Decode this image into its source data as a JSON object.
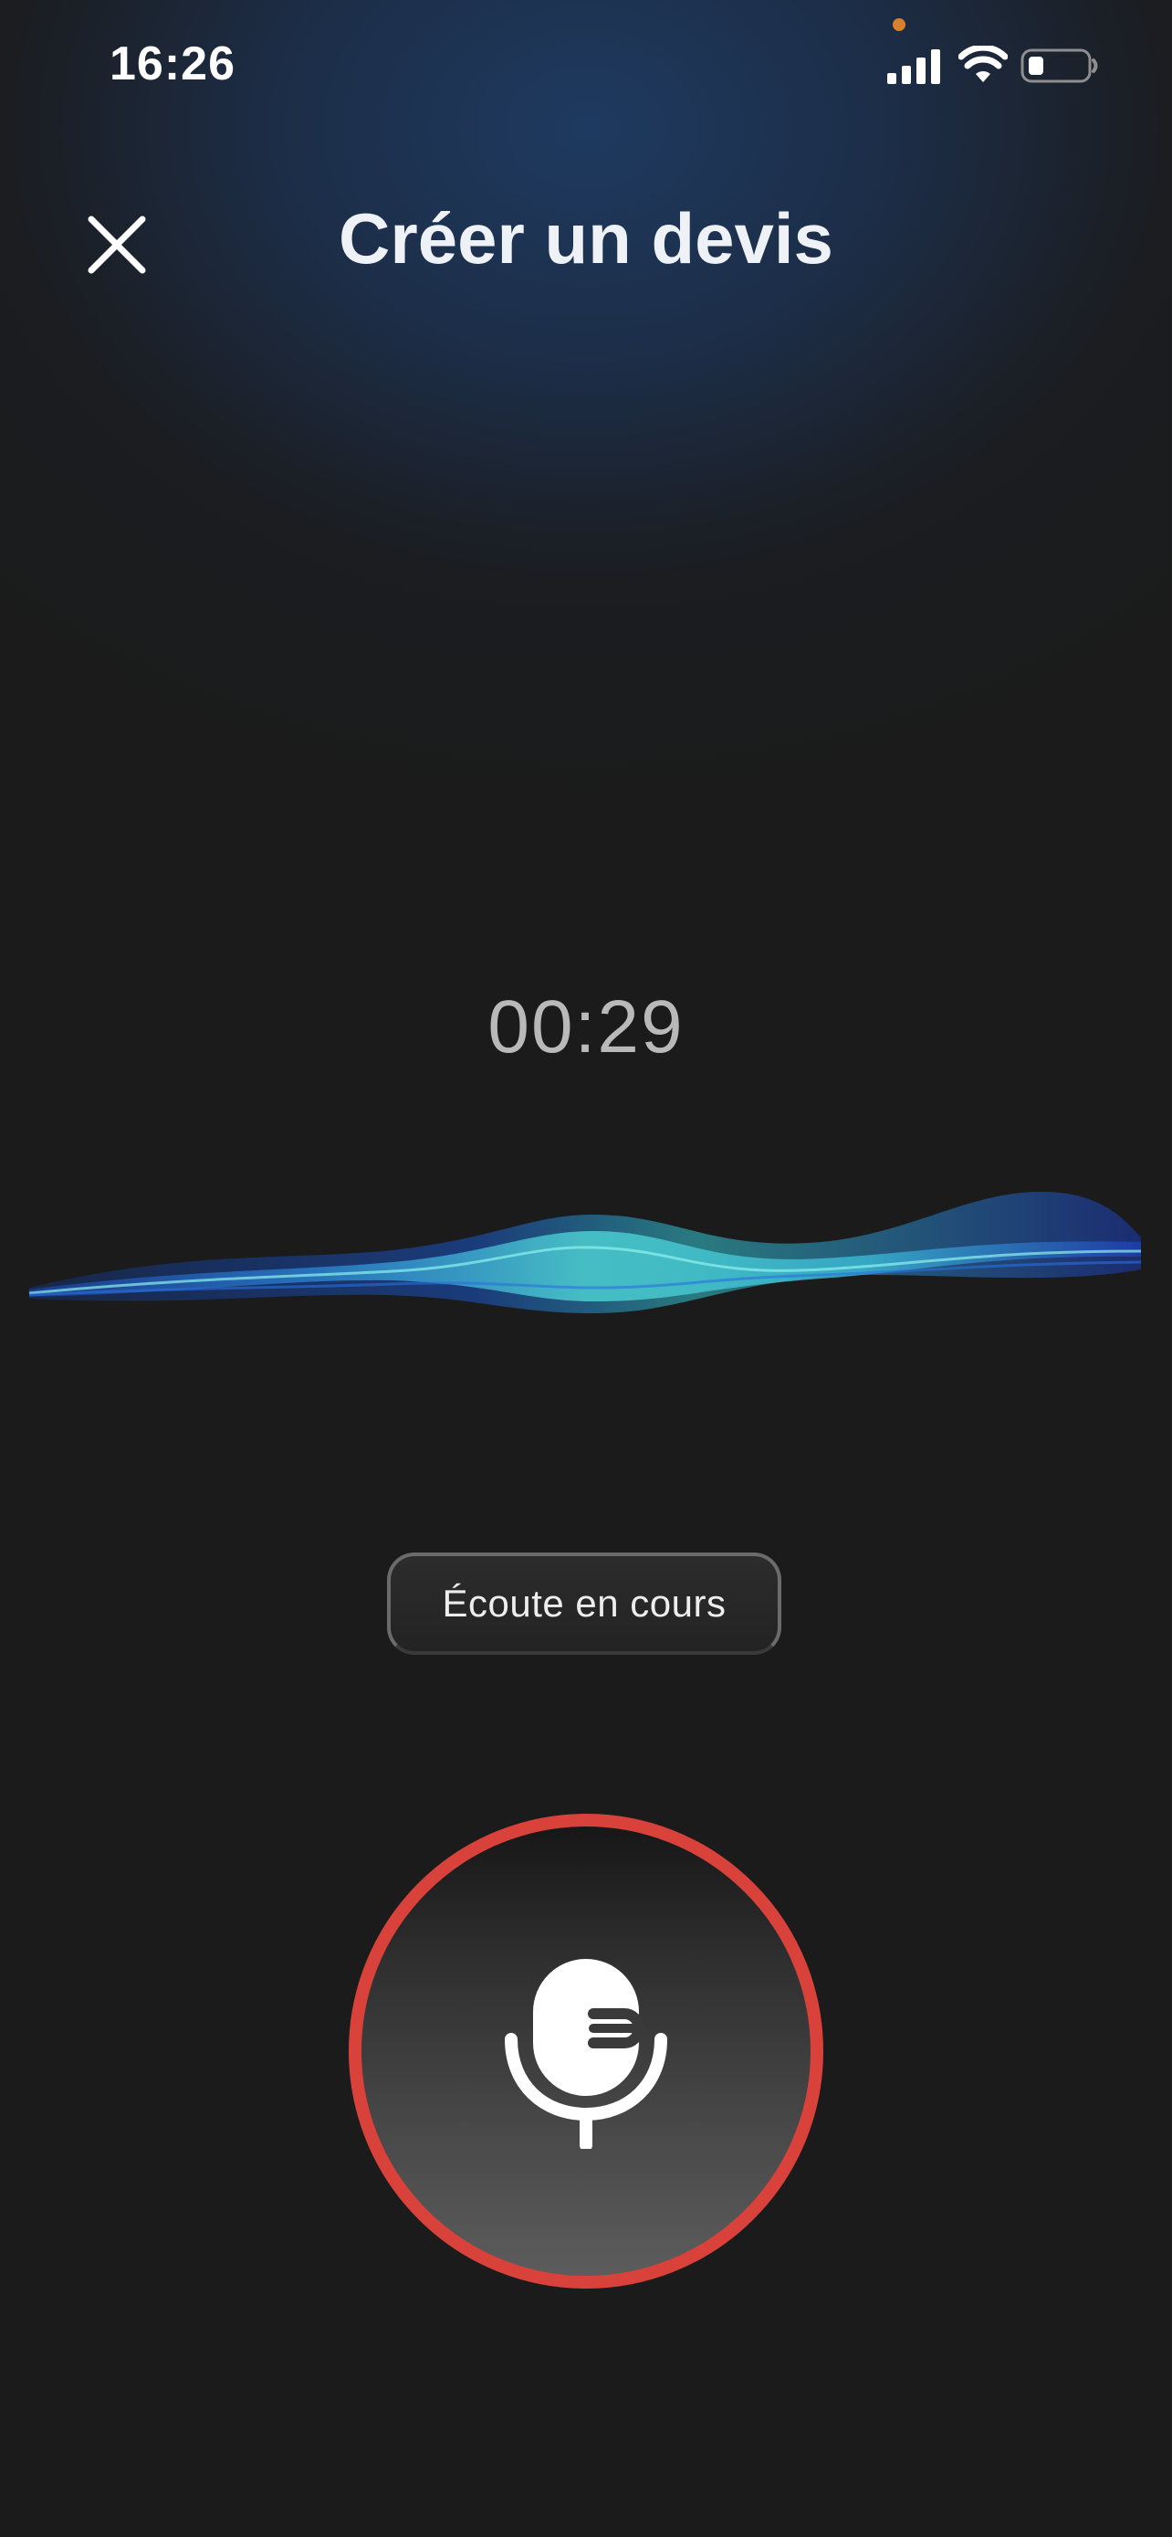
{
  "status_bar": {
    "time": "16:26",
    "icons": [
      "signal-icon",
      "wifi-icon",
      "battery-icon"
    ],
    "privacy_indicator_color": "#d9802e"
  },
  "header": {
    "title": "Créer un devis",
    "close_icon": "close-icon"
  },
  "recording": {
    "timer": "00:29",
    "status_label": "Écoute en cours",
    "mic_icon": "microphone-icon"
  },
  "colors": {
    "background": "#1b1b1b",
    "header_glow": "#1f3a60",
    "accent_ring": "#d8423b",
    "wave_cyan": "#4fd6d6",
    "wave_blue": "#1f5ad8"
  }
}
